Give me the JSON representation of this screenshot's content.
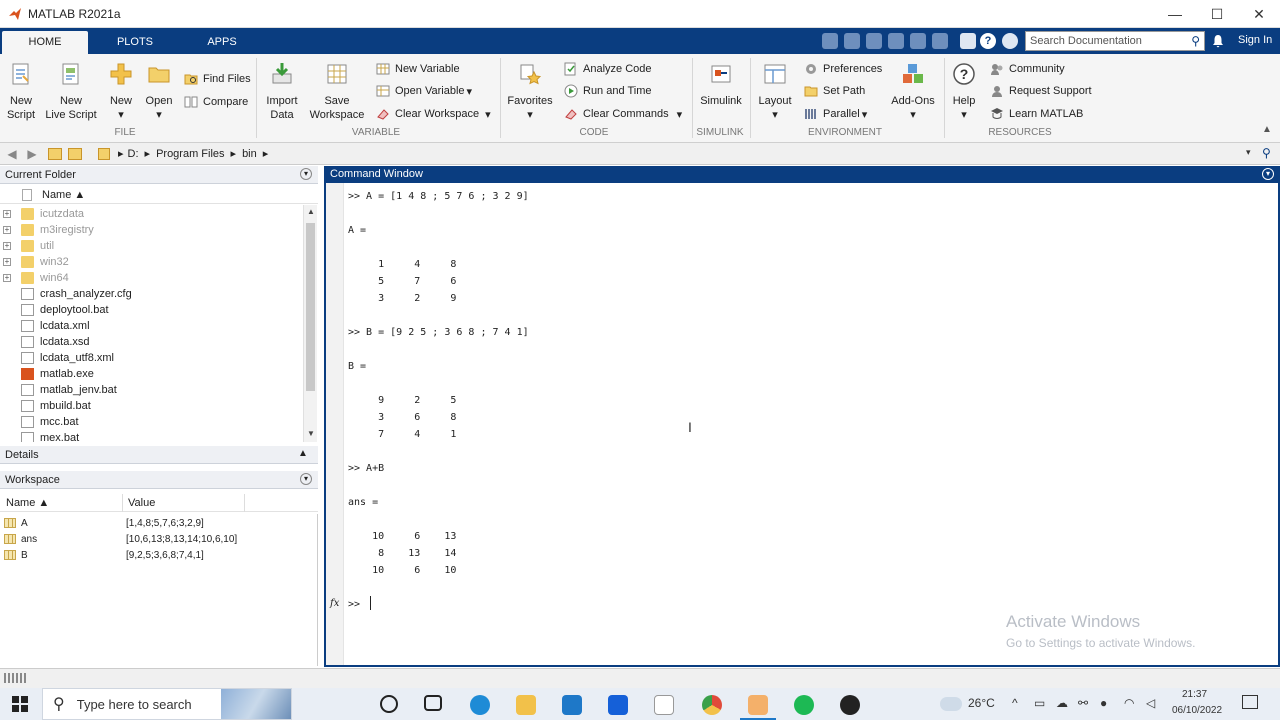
{
  "window": {
    "title": "MATLAB R2021a",
    "minimize": "—",
    "maximize": "☐",
    "close": "✕"
  },
  "tabs": [
    {
      "label": "HOME"
    },
    {
      "label": "PLOTS"
    },
    {
      "label": "APPS"
    }
  ],
  "search_doc": {
    "placeholder": "Search Documentation"
  },
  "notification_icon": "bell-icon",
  "sign_in": "Sign In",
  "ribbon": {
    "file": {
      "new_script": [
        "New",
        "Script"
      ],
      "new_live_script": [
        "New",
        "Live Script"
      ],
      "new": "New",
      "open": "Open",
      "find_files": "Find Files",
      "compare": "Compare",
      "group_label": "FILE"
    },
    "variable": {
      "import_data": [
        "Import",
        "Data"
      ],
      "save_workspace": [
        "Save",
        "Workspace"
      ],
      "new_variable": "New Variable",
      "open_variable": "Open Variable",
      "clear_workspace": "Clear Workspace",
      "group_label": "VARIABLE"
    },
    "code": {
      "favorites": "Favorites",
      "analyze_code": "Analyze Code",
      "run_and_time": "Run and Time",
      "clear_commands": "Clear Commands",
      "group_label": "CODE"
    },
    "simulink": {
      "simulink": "Simulink",
      "group_label": "SIMULINK"
    },
    "environment": {
      "layout": "Layout",
      "preferences": "Preferences",
      "set_path": "Set Path",
      "parallel": "Parallel",
      "add_ons": "Add-Ons",
      "group_label": "ENVIRONMENT"
    },
    "resources": {
      "help": "Help",
      "community": "Community",
      "request_support": "Request Support",
      "learn_matlab": "Learn MATLAB",
      "group_label": "RESOURCES"
    }
  },
  "address": {
    "drive": "D:",
    "path": [
      "Program Files",
      "bin"
    ]
  },
  "current_folder": {
    "title": "Current Folder",
    "name_col": "Name ▲",
    "items": [
      {
        "name": "icutzdata",
        "type": "folder"
      },
      {
        "name": "m3iregistry",
        "type": "folder"
      },
      {
        "name": "util",
        "type": "folder"
      },
      {
        "name": "win32",
        "type": "folder"
      },
      {
        "name": "win64",
        "type": "folder"
      },
      {
        "name": "crash_analyzer.cfg",
        "type": "file"
      },
      {
        "name": "deploytool.bat",
        "type": "file"
      },
      {
        "name": "lcdata.xml",
        "type": "file"
      },
      {
        "name": "lcdata.xsd",
        "type": "file"
      },
      {
        "name": "lcdata_utf8.xml",
        "type": "file"
      },
      {
        "name": "matlab.exe",
        "type": "exe"
      },
      {
        "name": "matlab_jenv.bat",
        "type": "file"
      },
      {
        "name": "mbuild.bat",
        "type": "file"
      },
      {
        "name": "mcc.bat",
        "type": "file"
      },
      {
        "name": "mex.bat",
        "type": "file"
      }
    ]
  },
  "details": {
    "title": "Details"
  },
  "workspace": {
    "title": "Workspace",
    "col_name": "Name ▲",
    "col_value": "Value",
    "rows": [
      {
        "name": "A",
        "value": "[1,4,8;5,7,6;3,2,9]"
      },
      {
        "name": "ans",
        "value": "[10,6,13;8,13,14;10,6,10]"
      },
      {
        "name": "B",
        "value": "[9,2,5;3,6,8;7,4,1]"
      }
    ]
  },
  "command_window": {
    "title": "Command Window",
    "lines": [
      ">> A = [1 4 8 ; 5 7 6 ; 3 2 9]",
      "A =",
      "     1     4     8",
      "     5     7     6",
      "     3     2     9",
      ">> B = [9 2 5 ; 3 6 8 ; 7 4 1]",
      "B =",
      "     9     2     5",
      "     3     6     8",
      "     7     4     1",
      ">> A+B",
      "ans =",
      "    10     6    13",
      "     8    13    14",
      "    10     6    10"
    ],
    "fx": "fx",
    "prompt": ">>"
  },
  "watermark": {
    "line1": "Activate Windows",
    "line2": "Go to Settings to activate Windows."
  },
  "taskbar": {
    "search_placeholder": "Type here to search",
    "temperature": "26°C",
    "time": "21:37",
    "date": "06/10/2022"
  }
}
